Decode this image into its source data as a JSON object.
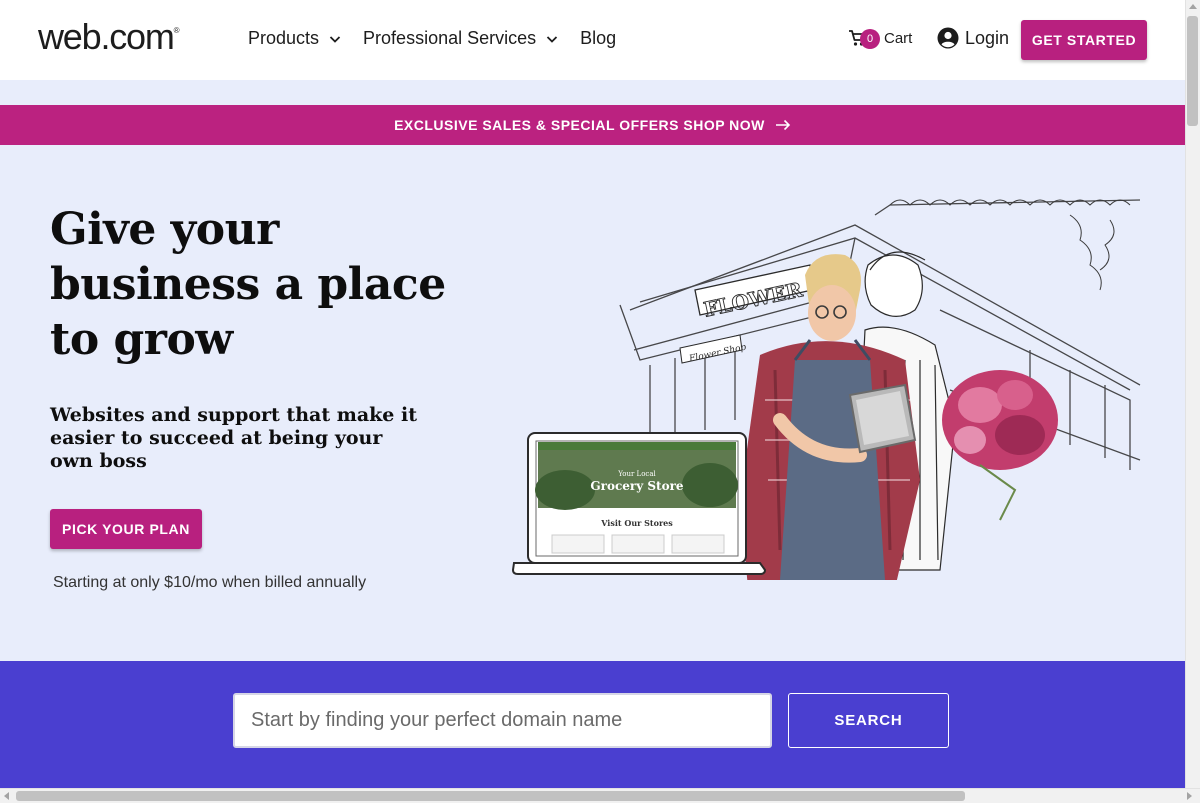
{
  "header": {
    "logo_text": "web.com",
    "logo_mark": "®",
    "nav": [
      {
        "label": "Products",
        "icon": "chevron-down-icon"
      },
      {
        "label": "Professional Services",
        "icon": "chevron-down-icon"
      },
      {
        "label": "Blog"
      }
    ],
    "cart": {
      "count": "0",
      "label": "Cart",
      "icon": "cart-icon"
    },
    "login": {
      "label": "Login",
      "icon": "user-circle-icon"
    },
    "cta_label": "GET STARTED"
  },
  "promo": {
    "text": "EXCLUSIVE SALES & SPECIAL OFFERS SHOP NOW",
    "icon": "arrow-right-icon"
  },
  "hero": {
    "title": "Give your business a place to grow",
    "subtitle": "Websites and support that make it easier to succeed at being your own boss",
    "cta_label": "PICK YOUR PLAN",
    "price_note": "Starting at only $10/mo when billed annually",
    "illustration": {
      "shop_sign": "FLOWER",
      "shop_subsign": "Flower Shop",
      "laptop_heading_small": "Your Local",
      "laptop_heading": "Grocery Store",
      "laptop_section": "Visit Our Stores"
    }
  },
  "search": {
    "placeholder": "Start by finding your perfect domain name",
    "button_label": "SEARCH"
  },
  "colors": {
    "brand_magenta": "#b8207f",
    "hero_bg": "#e8edfb",
    "search_band": "#4a3fd0"
  }
}
